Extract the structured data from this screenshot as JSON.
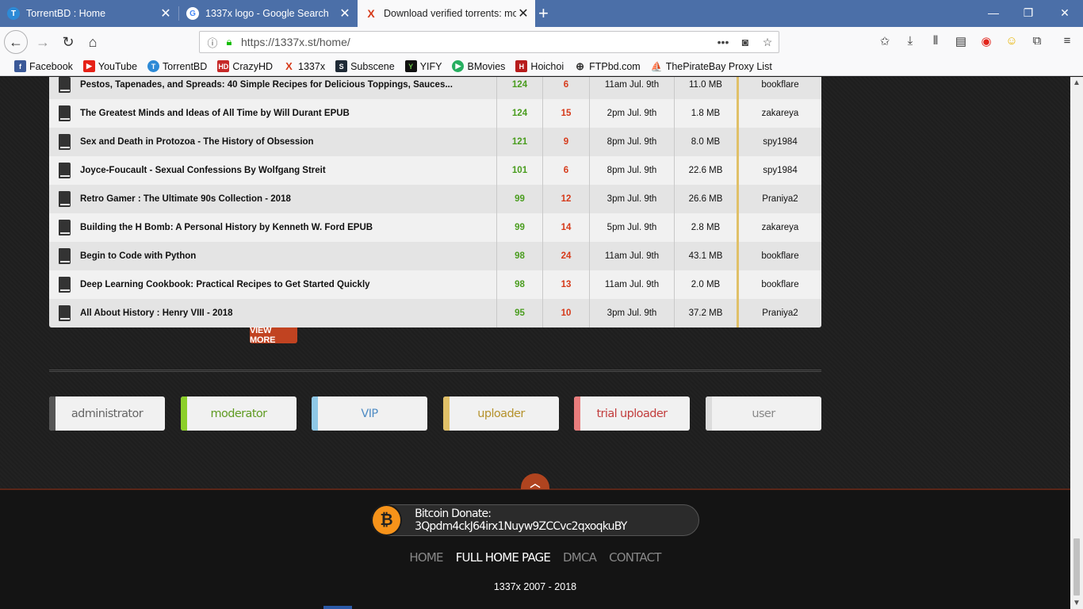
{
  "browser": {
    "tabs": [
      {
        "title": "TorrentBD : Home",
        "icon": "torrentbd-icon"
      },
      {
        "title": "1337x logo - Google Search",
        "icon": "google-icon"
      },
      {
        "title": "Download verified torrents: mo",
        "icon": "1337x-icon",
        "active": true
      }
    ],
    "url": "https://1337x.st/home/",
    "bookmarks": [
      "Facebook",
      "YouTube",
      "TorrentBD",
      "CrazyHD",
      "1337x",
      "Subscene",
      "YIFY",
      "BMovies",
      "Hoichoi",
      "FTPbd.com",
      "ThePirateBay Proxy List"
    ]
  },
  "torrents": [
    {
      "name": "Pestos, Tapenades, and Spreads: 40 Simple Recipes for Delicious Toppings, Sauces...",
      "se": "124",
      "le": "6",
      "time": "11am Jul. 9th",
      "size": "11.0 MB",
      "uploader": "bookflare"
    },
    {
      "name": "The Greatest Minds and Ideas of All Time by Will Durant EPUB",
      "se": "124",
      "le": "15",
      "time": "2pm Jul. 9th",
      "size": "1.8 MB",
      "uploader": "zakareya"
    },
    {
      "name": "Sex and Death in Protozoa - The History of Obsession",
      "se": "121",
      "le": "9",
      "time": "8pm Jul. 9th",
      "size": "8.0 MB",
      "uploader": "spy1984"
    },
    {
      "name": "Joyce-Foucault - Sexual Confessions By Wolfgang Streit",
      "se": "101",
      "le": "6",
      "time": "8pm Jul. 9th",
      "size": "22.6 MB",
      "uploader": "spy1984"
    },
    {
      "name": "Retro Gamer : The Ultimate 90s Collection - 2018",
      "se": "99",
      "le": "12",
      "time": "3pm Jul. 9th",
      "size": "26.6 MB",
      "uploader": "Praniya2"
    },
    {
      "name": "Building the H Bomb: A Personal History by Kenneth W. Ford EPUB",
      "se": "99",
      "le": "14",
      "time": "5pm Jul. 9th",
      "size": "2.8 MB",
      "uploader": "zakareya"
    },
    {
      "name": "Begin to Code with Python",
      "se": "98",
      "le": "24",
      "time": "11am Jul. 9th",
      "size": "43.1 MB",
      "uploader": "bookflare"
    },
    {
      "name": "Deep Learning Cookbook: Practical Recipes to Get Started Quickly",
      "se": "98",
      "le": "13",
      "time": "11am Jul. 9th",
      "size": "2.0 MB",
      "uploader": "bookflare"
    },
    {
      "name": "All About History : Henry VIII - 2018",
      "se": "95",
      "le": "10",
      "time": "3pm Jul. 9th",
      "size": "37.2 MB",
      "uploader": "Praniya2"
    }
  ],
  "view_more": "VIEW MORE",
  "roles": [
    {
      "label": "administrator",
      "color": "#555555",
      "text": "#666666"
    },
    {
      "label": "moderator",
      "color": "#8ccf2a",
      "text": "#5f9b22"
    },
    {
      "label": "VIP",
      "color": "#8fc8e6",
      "text": "#4f8cc4"
    },
    {
      "label": "uploader",
      "color": "#e0c068",
      "text": "#b5922c"
    },
    {
      "label": "trial uploader",
      "color": "#e87c7c",
      "text": "#c23d3d"
    },
    {
      "label": "user",
      "color": "#dcdcdc",
      "text": "#888888"
    }
  ],
  "footer": {
    "bitcoin": "Bitcoin Donate: 3Qpdm4ckJ64irx1Nuyw9ZCCvc2qxoqkuBY",
    "links": [
      "HOME",
      "FULL HOME PAGE",
      "DMCA",
      "CONTACT"
    ],
    "copyright": "1337x 2007 - 2018"
  }
}
